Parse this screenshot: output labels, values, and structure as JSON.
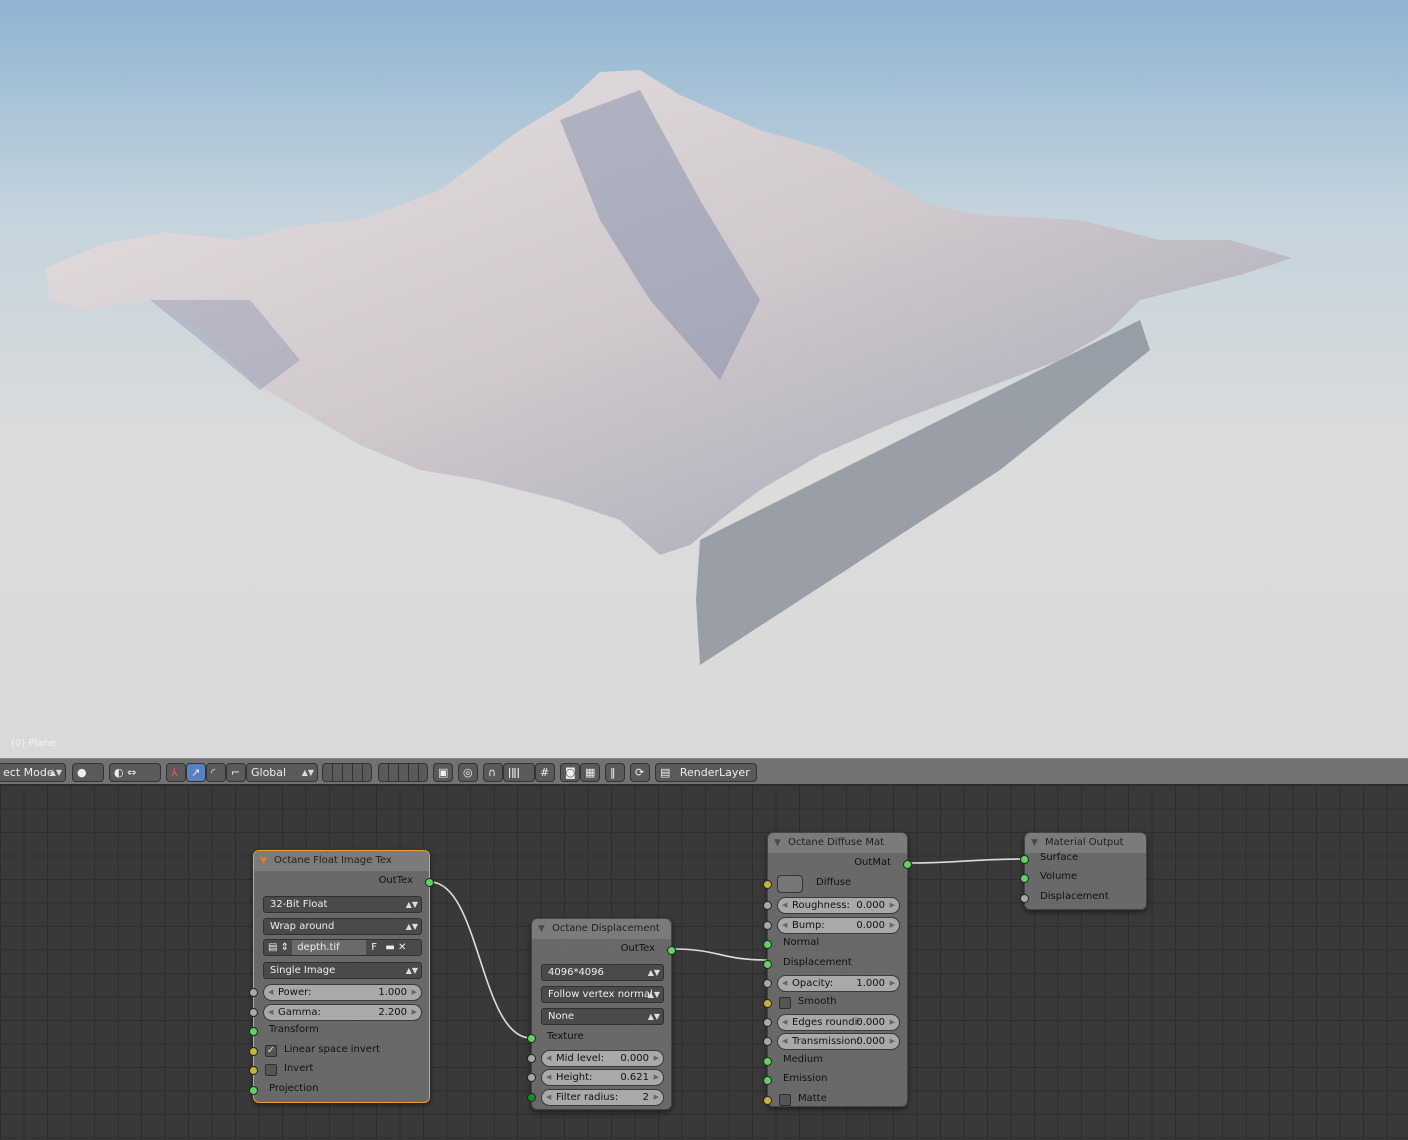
{
  "viewport": {
    "object_label": "(0) Plane"
  },
  "toolbar": {
    "mode": "ect Mode",
    "transform_orientation": "Global",
    "render_layer": "RenderLayer",
    "icons": [
      "shading-sphere-icon",
      "pivot-icon",
      "manipulator-icon",
      "translate-icon",
      "rotate-icon",
      "scale-icon",
      "layers-icon",
      "lock-camera-icon",
      "proportional-edit-icon",
      "snap-icon",
      "snap-target-icon",
      "render-icon",
      "render-animation-icon",
      "pause-icon",
      "refresh-icon",
      "render-layer-icon"
    ]
  },
  "colors": {
    "socket_green": "#5fd35f",
    "socket_gray": "#a8a8a8",
    "socket_yellow": "#c4b43a",
    "socket_darkgreen": "#188a28",
    "selected_border": "#f0a030"
  },
  "nodes": [
    {
      "id": "float-image-tex",
      "title": "Octane Float Image Tex",
      "selected": true,
      "rows": [
        {
          "type": "out",
          "label": "OutTex",
          "sock": "green"
        },
        {
          "type": "dropdown",
          "label": "32-Bit Float"
        },
        {
          "type": "dropdown",
          "label": "Wrap around"
        },
        {
          "type": "file",
          "label": "depth.tif",
          "flag": "F"
        },
        {
          "type": "dropdown",
          "label": "Single Image"
        },
        {
          "type": "field",
          "label": "Power:",
          "value": "1.000",
          "sock": "gray"
        },
        {
          "type": "field",
          "label": "Gamma:",
          "value": "2.200",
          "sock": "gray"
        },
        {
          "type": "in",
          "label": "Transform",
          "sock": "green"
        },
        {
          "type": "check",
          "label": "Linear space invert",
          "checked": true,
          "sock": "yellow"
        },
        {
          "type": "check",
          "label": "Invert",
          "checked": false,
          "sock": "yellow"
        },
        {
          "type": "in",
          "label": "Projection",
          "sock": "green"
        }
      ]
    },
    {
      "id": "displacement",
      "title": "Octane Displacement",
      "selected": false,
      "rows": [
        {
          "type": "out",
          "label": "OutTex",
          "sock": "green"
        },
        {
          "type": "dropdown",
          "label": "4096*4096"
        },
        {
          "type": "dropdown",
          "label": "Follow vertex normal"
        },
        {
          "type": "dropdown",
          "label": "None"
        },
        {
          "type": "in",
          "label": "Texture",
          "sock": "green"
        },
        {
          "type": "field",
          "label": "Mid level:",
          "value": "0.000",
          "sock": "gray"
        },
        {
          "type": "field",
          "label": "Height:",
          "value": "0.621",
          "sock": "gray"
        },
        {
          "type": "field",
          "label": "Filter radius:",
          "value": "2",
          "sock": "darkgreen"
        }
      ]
    },
    {
      "id": "diffuse-mat",
      "title": "Octane Diffuse Mat",
      "selected": false,
      "rows": [
        {
          "type": "out",
          "label": "OutMat",
          "sock": "green"
        },
        {
          "type": "color",
          "label": "Diffuse",
          "sock": "yellow"
        },
        {
          "type": "field",
          "label": "Roughness:",
          "value": "0.000",
          "sock": "gray"
        },
        {
          "type": "field",
          "label": "Bump:",
          "value": "0.000",
          "sock": "gray"
        },
        {
          "type": "in",
          "label": "Normal",
          "sock": "green"
        },
        {
          "type": "in",
          "label": "Displacement",
          "sock": "green"
        },
        {
          "type": "field",
          "label": "Opacity:",
          "value": "1.000",
          "sock": "gray"
        },
        {
          "type": "check",
          "label": "Smooth",
          "checked": false,
          "sock": "yellow"
        },
        {
          "type": "field",
          "label": "Edges roundi:",
          "value": "0.000",
          "sock": "gray"
        },
        {
          "type": "field",
          "label": "Transmission:",
          "value": "0.000",
          "sock": "gray"
        },
        {
          "type": "in",
          "label": "Medium",
          "sock": "green"
        },
        {
          "type": "in",
          "label": "Emission",
          "sock": "green"
        },
        {
          "type": "check",
          "label": "Matte",
          "checked": false,
          "sock": "yellow"
        }
      ]
    },
    {
      "id": "material-output",
      "title": "Material Output",
      "selected": false,
      "rows": [
        {
          "type": "in",
          "label": "Surface",
          "sock": "green"
        },
        {
          "type": "in",
          "label": "Volume",
          "sock": "green"
        },
        {
          "type": "in",
          "label": "Displacement",
          "sock": "gray"
        }
      ]
    }
  ]
}
